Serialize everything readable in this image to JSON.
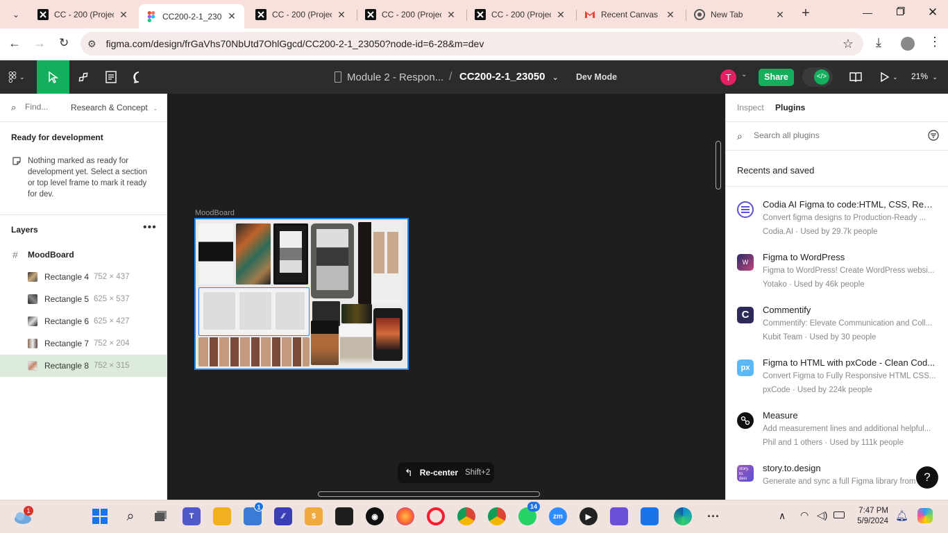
{
  "browser": {
    "tabs": [
      {
        "title": "CC - 200 (Project",
        "icon": "figma-x-icon",
        "active": false
      },
      {
        "title": "CC200-2-1_2305",
        "icon": "figma-icon",
        "active": true
      },
      {
        "title": "CC - 200 (Projec",
        "icon": "figma-x-icon",
        "active": false
      },
      {
        "title": "CC - 200 (Projec",
        "icon": "figma-x-icon",
        "active": false
      },
      {
        "title": "CC - 200 (Projec",
        "icon": "figma-x-icon",
        "active": false
      },
      {
        "title": "Recent Canvas n",
        "icon": "gmail-icon",
        "active": false
      },
      {
        "title": "New Tab",
        "icon": "chrome-icon",
        "active": false
      }
    ],
    "url": "figma.com/design/frGaVhs70NbUtd7OhlGgcd/CC200-2-1_23050?node-id=6-28&m=dev"
  },
  "figma_toolbar": {
    "project": "Module 2 - Respon...",
    "separator": "/",
    "file": "CC200-2-1_23050",
    "mode": "Dev Mode",
    "avatar_letter": "T",
    "share": "Share",
    "zoom": "21%"
  },
  "left_panel": {
    "find_placeholder": "Find...",
    "page": "Research & Concept",
    "ready_heading": "Ready for development",
    "ready_text": "Nothing marked as ready for development yet. Select a section or top level frame to mark it ready for dev.",
    "layers_heading": "Layers",
    "layers": [
      {
        "name": "MoodBoard",
        "size": ""
      },
      {
        "name": "Rectangle 4",
        "size": "752 × 437"
      },
      {
        "name": "Rectangle 5",
        "size": "625 × 537"
      },
      {
        "name": "Rectangle 6",
        "size": "625 × 427"
      },
      {
        "name": "Rectangle 7",
        "size": "752 × 204"
      },
      {
        "name": "Rectangle 8",
        "size": "752 × 315"
      }
    ]
  },
  "canvas": {
    "frame_label": "MoodBoard",
    "recenter": "Re-center",
    "shortcut": "Shift+2"
  },
  "right_panel": {
    "tabs": [
      "Inspect",
      "Plugins"
    ],
    "search_placeholder": "Search all plugins",
    "section": "Recents and saved",
    "plugins": [
      {
        "name": "Codia AI Figma to code:HTML, CSS, Reac...",
        "desc": "Convert figma designs to Production-Ready ...",
        "meta": "Codia.AI · Used by 29.7k people",
        "color": "#5b4fd6",
        "icon": "codia-icon"
      },
      {
        "name": "Figma to WordPress",
        "desc": "Figma to WordPress! Create WordPress websi...",
        "meta": "Yotako · Used by 46k people",
        "color": "#7a2f6b",
        "icon": "wordpress-icon"
      },
      {
        "name": "Commentify",
        "desc": "Commentify: Elevate Communication and Coll...",
        "meta": "Kubit Team · Used by 30 people",
        "color": "#2d2a5a",
        "icon": "commentify-icon"
      },
      {
        "name": "Figma to HTML with pxCode - Clean Cod...",
        "desc": "Convert Figma to Fully Responsive HTML CSS...",
        "meta": "pxCode · Used by 224k people",
        "color": "#4ba7f0",
        "icon": "pxcode-icon"
      },
      {
        "name": "Measure",
        "desc": "Add measurement lines and additional helpful...",
        "meta": "Phil and 1 others · Used by 111k people",
        "color": "#111111",
        "icon": "measure-icon"
      },
      {
        "name": "story.to.design",
        "desc": "Generate and sync a full Figma library from ...",
        "meta": "",
        "color": "#9b59b6",
        "icon": "story-icon"
      }
    ]
  },
  "taskbar": {
    "time": "7:47 PM",
    "date": "5/9/2024",
    "weather_badge": "1",
    "store_badge": "1",
    "whatsapp_badge": "14"
  }
}
